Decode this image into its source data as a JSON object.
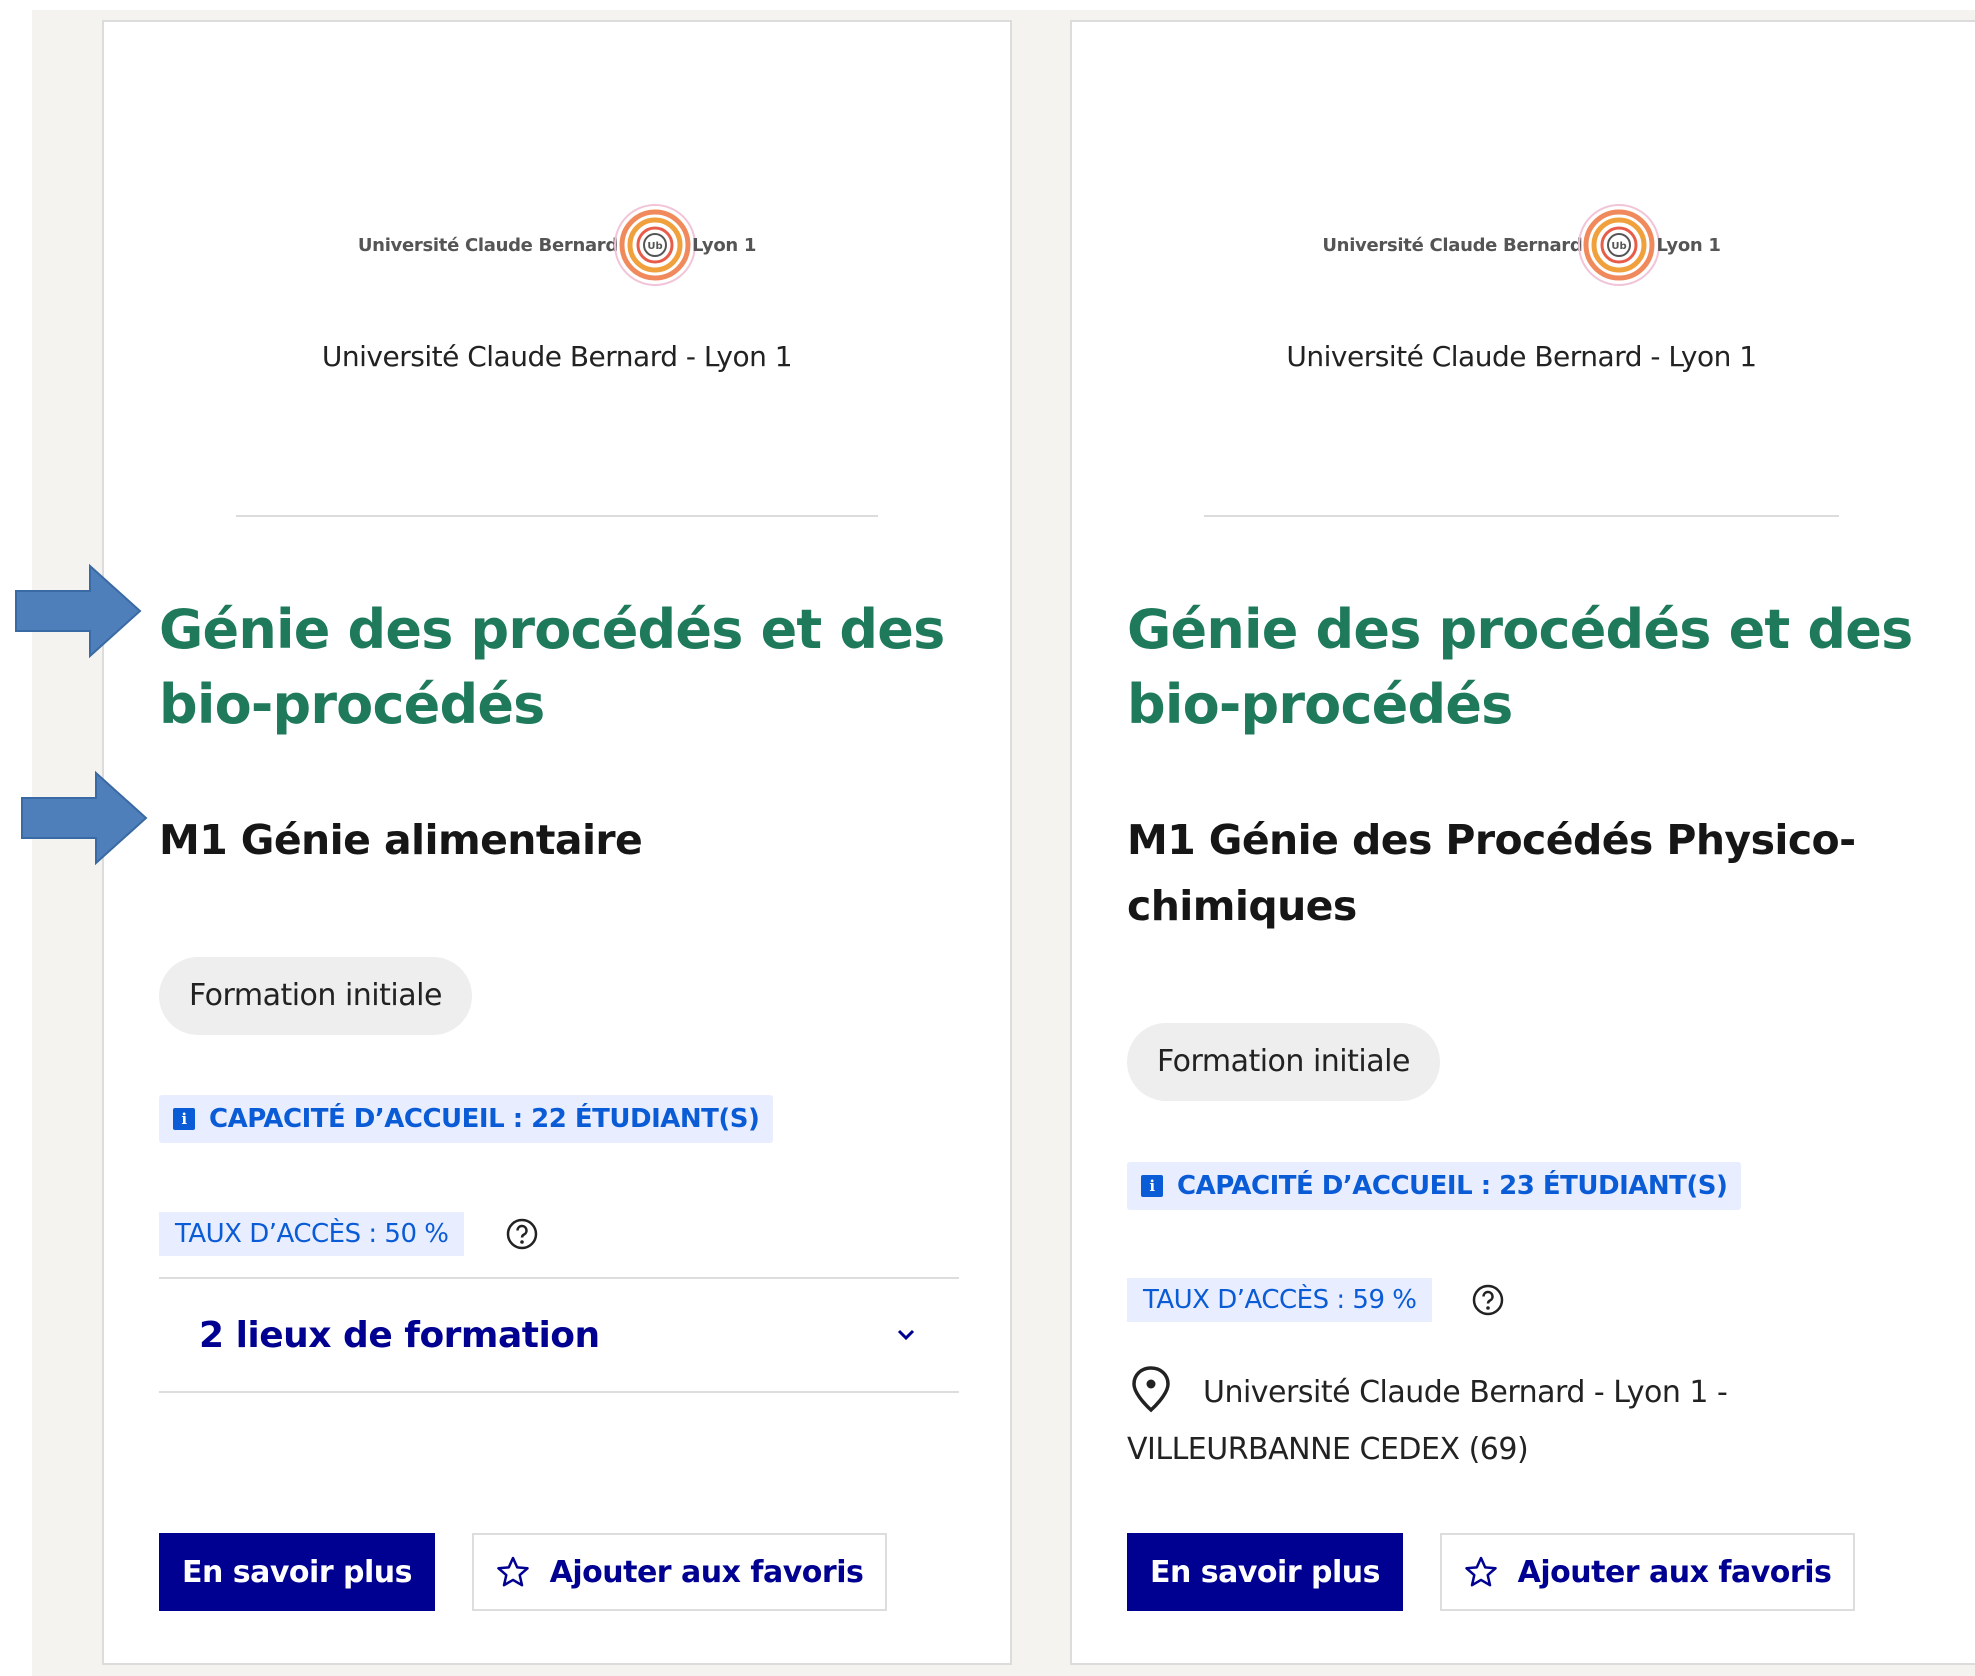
{
  "colors": {
    "domain_title": "#1f7a5c",
    "primary": "#000091",
    "badge_text": "#0a5bd6",
    "badge_bg": "#e8edff",
    "annotation_arrow": "#4f7fba"
  },
  "cards": [
    {
      "logo": {
        "left_text": "Université Claude Bernard",
        "right_text": "Lyon 1",
        "mark": "ucbl-spiral-logo"
      },
      "university": "Université Claude Bernard - Lyon 1",
      "domain": "Génie des procédés et des bio-procédés",
      "mention": "M1 Génie alimentaire",
      "tag": "Formation initiale",
      "capacity": "CAPACITÉ D’ACCUEIL : 22 ÉTUDIANT(S)",
      "taux": "TAUX D’ACCÈS : 50 %",
      "lieux": "2 lieux de formation",
      "btn_more": "En savoir plus",
      "btn_fav": "Ajouter aux favoris"
    },
    {
      "logo": {
        "left_text": "Université Claude Bernard",
        "right_text": "Lyon 1",
        "mark": "ucbl-spiral-logo"
      },
      "university": "Université Claude Bernard - Lyon 1",
      "domain": "Génie des procédés et des bio-procédés",
      "mention": "M1 Génie des Procédés Physico-chimiques",
      "tag": "Formation initiale",
      "capacity": "CAPACITÉ D’ACCUEIL : 23 ÉTUDIANT(S)",
      "taux": "TAUX D’ACCÈS : 59 %",
      "address": "Université Claude Bernard - Lyon 1 - VILLEURBANNE CEDEX (69)",
      "btn_more": "En savoir plus",
      "btn_fav": "Ajouter aux favoris"
    }
  ]
}
